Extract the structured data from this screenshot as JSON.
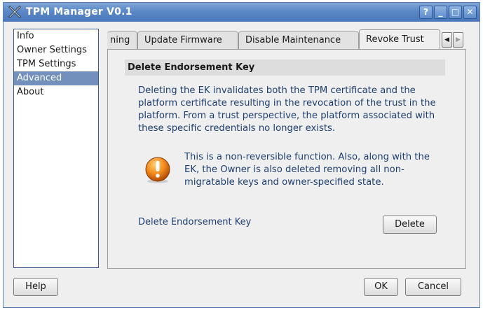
{
  "window": {
    "title": "TPM Manager V0.1",
    "buttons": {
      "help": "?",
      "minimize": "_",
      "maximize": "□",
      "close": "✕"
    }
  },
  "sidebar": {
    "items": [
      {
        "label": "Info"
      },
      {
        "label": "Owner Settings"
      },
      {
        "label": "TPM Settings"
      },
      {
        "label": "Advanced",
        "selected": true
      },
      {
        "label": "About"
      }
    ]
  },
  "tabs": [
    {
      "label": "ning"
    },
    {
      "label": "Update Firmware",
      "mnemonic": "U"
    },
    {
      "label": "Disable Maintenance",
      "mnemonic": "D"
    },
    {
      "label": "Revoke Trust",
      "mnemonic": "R",
      "active": true
    }
  ],
  "tab_scroll": {
    "left": "◀",
    "right": "▶"
  },
  "section": {
    "title": "Delete Endorsement Key",
    "description": "Deleting the EK invalidates both the TPM certificate and the platform certificate resulting in the revocation of the trust in the platform. From a trust perspective, the platform associated with these specific credentials no longer exists.",
    "warning": "This is a non-reversible function. Also, along with the EK, the Owner is also deleted removing all non-migratable keys and owner-specified state.",
    "action_label": "Delete Endorsement Key",
    "delete_button": "Delete"
  },
  "footer": {
    "help_button": "Help",
    "ok_button": "OK",
    "cancel_button": "Cancel"
  },
  "colors": {
    "titlebar": "#5a87c6",
    "selection": "#7390bd",
    "text_blue": "#1e3f70"
  }
}
